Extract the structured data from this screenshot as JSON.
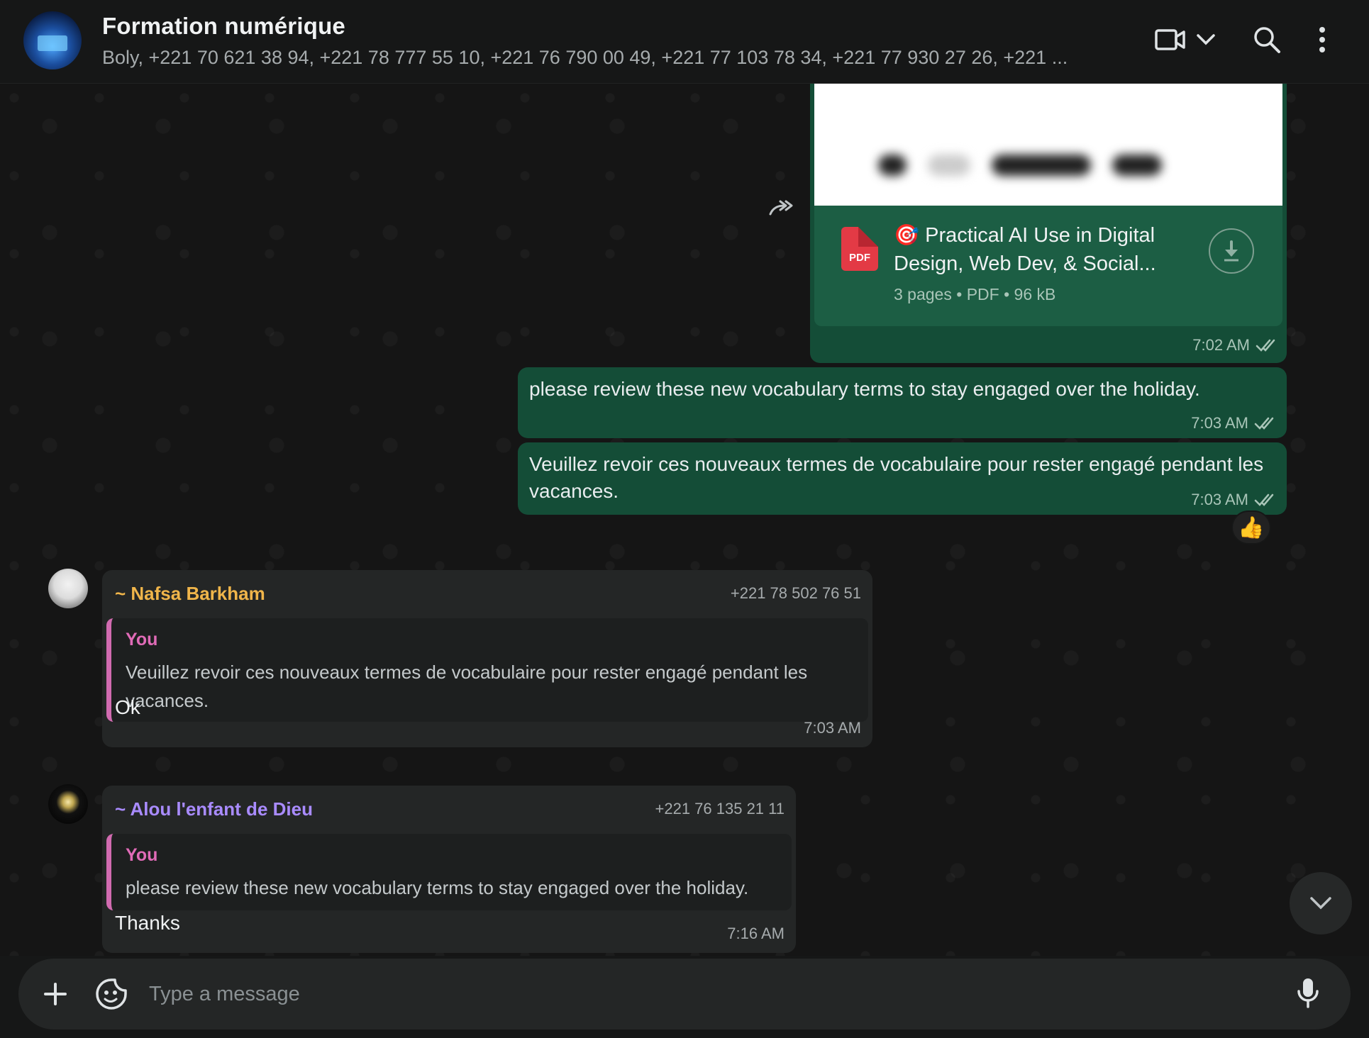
{
  "header": {
    "title": "Formation  numérique",
    "subtitle": "Boly, +221 70 621 38 94, +221 78 777 55 10, +221 76 790 00 49, +221 77 103 78 34, +221 77 930 27 26, +221 ...",
    "icons": [
      "video-icon",
      "chevron-down-icon",
      "search-icon",
      "more-vert-icon"
    ]
  },
  "document_message": {
    "emoji": "🎯",
    "title": "Practical AI Use in Digital Design, Web Dev, & Social...",
    "file_type_badge": "PDF",
    "meta_pages": "3 pages",
    "meta_type": "PDF",
    "meta_size": "96 kB",
    "time": "7:02 AM"
  },
  "outgoing_messages": [
    {
      "text": "please review these new vocabulary terms to stay engaged over the holiday.",
      "time": "7:03 AM"
    },
    {
      "text": "Veuillez revoir ces nouveaux termes de vocabulaire pour rester engagé pendant les vacances.",
      "time": "7:03 AM",
      "reaction": "👍"
    }
  ],
  "incoming_messages": [
    {
      "sender": "~ Nafsa Barkham",
      "sender_color": "#f0b54a",
      "phone": "+221 78 502 76 51",
      "quote_author": "You",
      "quote_text": "Veuillez revoir ces nouveaux termes de vocabulaire pour rester engagé pendant les vacances.",
      "text": "Ok",
      "time": "7:03 AM"
    },
    {
      "sender": "~ Alou l'enfant de Dieu",
      "sender_color": "#a98bff",
      "phone": "+221 76 135 21 11",
      "quote_author": "You",
      "quote_text": "please review these new vocabulary terms to stay engaged over the holiday.",
      "text": "Thanks",
      "time": "7:16 AM"
    }
  ],
  "composer": {
    "placeholder": "Type a message",
    "icons": [
      "plus-icon",
      "sticker-icon",
      "mic-icon"
    ]
  },
  "colors": {
    "outgoing_bubble": "#144d37",
    "incoming_bubble": "#242626",
    "quote_bar": "#d16bb0"
  }
}
